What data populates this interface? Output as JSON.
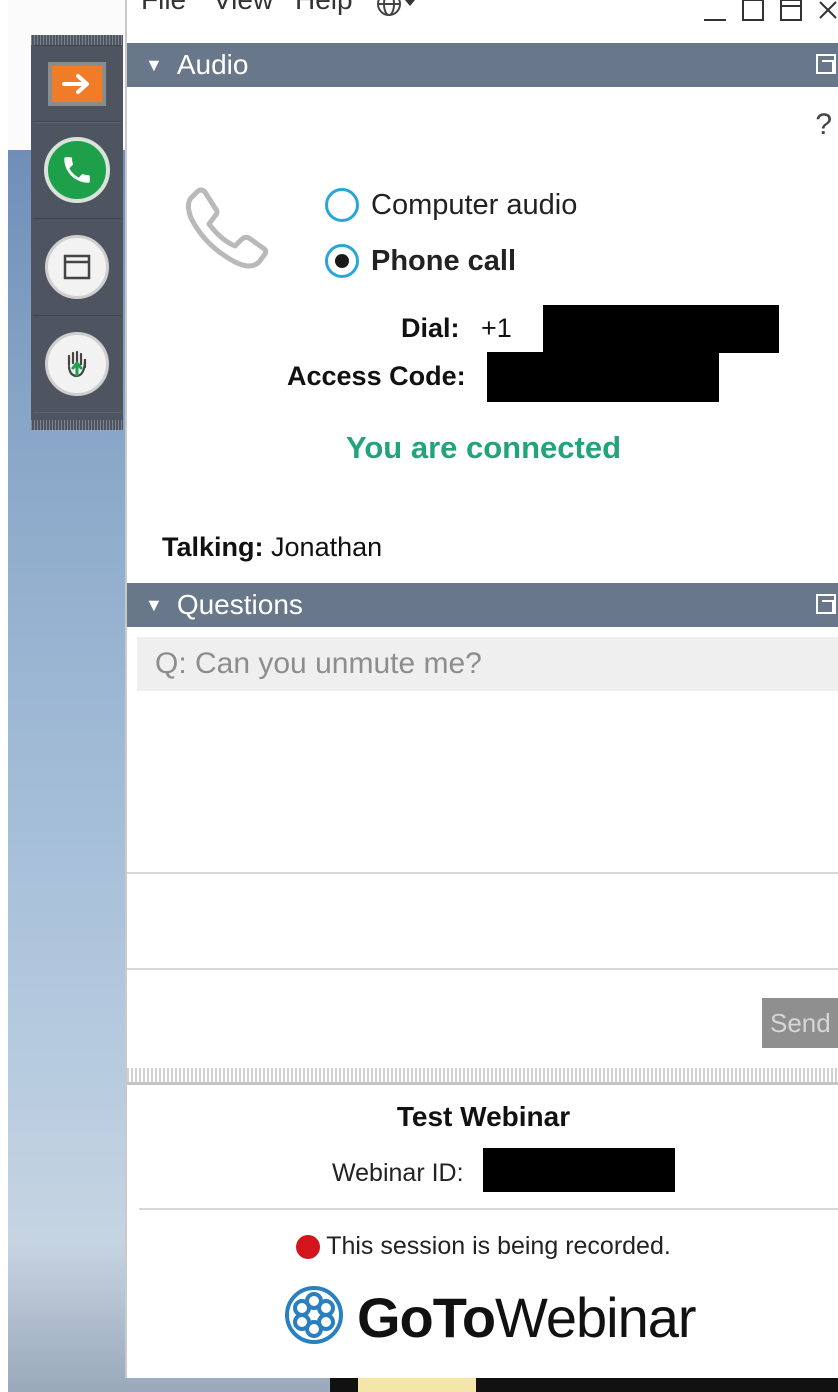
{
  "menubar": {
    "items": [
      "File",
      "View",
      "Help"
    ],
    "globe_icon": "globe-icon"
  },
  "audio": {
    "header": "Audio",
    "help": "?",
    "options": [
      {
        "label": "Computer audio",
        "selected": false
      },
      {
        "label": "Phone call",
        "selected": true
      }
    ],
    "dial_label": "Dial:",
    "dial_prefix": "+1",
    "access_code_label": "Access Code:",
    "status": "You are connected",
    "talking_label": "Talking:",
    "talking_name": "Jonathan"
  },
  "questions": {
    "header": "Questions",
    "items": [
      "Q: Can you unmute me?"
    ],
    "send_label": "Send"
  },
  "footer": {
    "webinar_title": "Test Webinar",
    "webinar_id_label": "Webinar ID:",
    "recording_notice": "This session is being recorded.",
    "brand_bold": "GoTo",
    "brand_light": "Webinar"
  },
  "colors": {
    "header_bg": "#69778b",
    "connected_green": "#22a37a",
    "radio_blue": "#29a5dc",
    "strip_bg": "#4e5561",
    "orange": "#f07c28",
    "phone_green": "#1ea04b",
    "record_red": "#d3141b",
    "brand_blue": "#2a7fc0"
  }
}
